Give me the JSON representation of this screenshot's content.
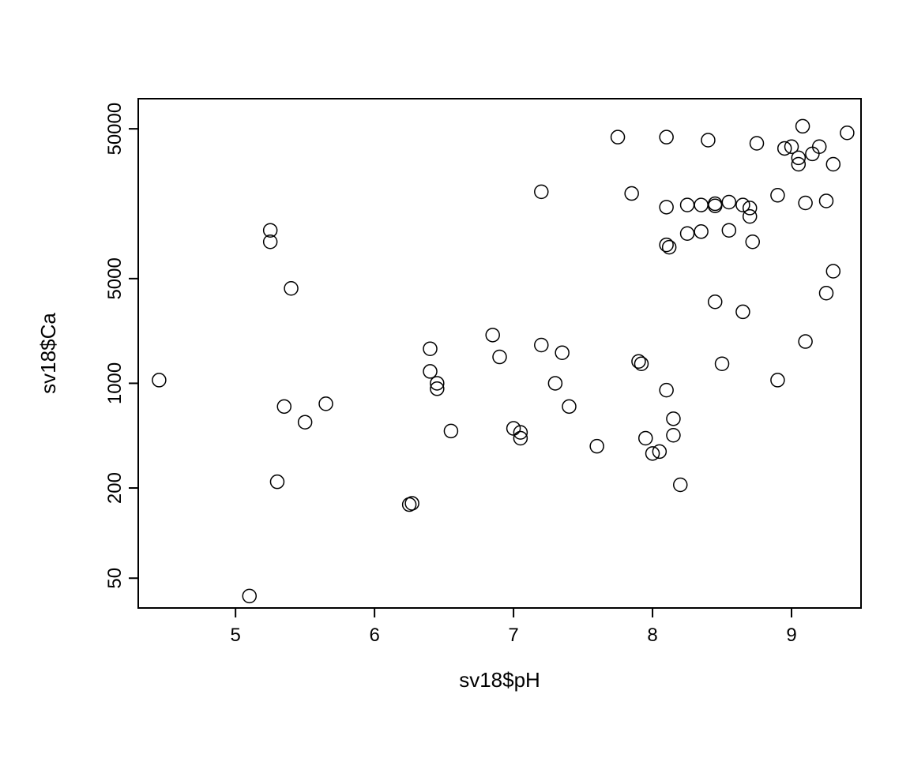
{
  "chart_data": {
    "type": "scatter",
    "xlabel": "sv18$pH",
    "ylabel": "sv18$Ca",
    "xlim": [
      4.3,
      9.5
    ],
    "ylim_log10": [
      1.5,
      4.9
    ],
    "x_ticks": [
      5,
      6,
      7,
      8,
      9
    ],
    "y_ticks": [
      50,
      200,
      1000,
      5000,
      50000
    ],
    "y_scale": "log",
    "points": [
      {
        "x": 4.45,
        "y": 1050
      },
      {
        "x": 5.1,
        "y": 38
      },
      {
        "x": 5.25,
        "y": 10500
      },
      {
        "x": 5.25,
        "y": 8800
      },
      {
        "x": 5.3,
        "y": 220
      },
      {
        "x": 5.35,
        "y": 700
      },
      {
        "x": 5.4,
        "y": 4300
      },
      {
        "x": 5.5,
        "y": 550
      },
      {
        "x": 5.65,
        "y": 730
      },
      {
        "x": 6.25,
        "y": 155
      },
      {
        "x": 6.27,
        "y": 158
      },
      {
        "x": 6.4,
        "y": 1700
      },
      {
        "x": 6.4,
        "y": 1200
      },
      {
        "x": 6.45,
        "y": 1000
      },
      {
        "x": 6.45,
        "y": 920
      },
      {
        "x": 6.55,
        "y": 480
      },
      {
        "x": 6.85,
        "y": 2100
      },
      {
        "x": 6.9,
        "y": 1500
      },
      {
        "x": 7.0,
        "y": 500
      },
      {
        "x": 7.05,
        "y": 470
      },
      {
        "x": 7.05,
        "y": 430
      },
      {
        "x": 7.2,
        "y": 1800
      },
      {
        "x": 7.2,
        "y": 19000
      },
      {
        "x": 7.3,
        "y": 1000
      },
      {
        "x": 7.35,
        "y": 1600
      },
      {
        "x": 7.4,
        "y": 700
      },
      {
        "x": 7.6,
        "y": 380
      },
      {
        "x": 7.75,
        "y": 44000
      },
      {
        "x": 7.85,
        "y": 18500
      },
      {
        "x": 7.9,
        "y": 1400
      },
      {
        "x": 7.92,
        "y": 1350
      },
      {
        "x": 7.95,
        "y": 430
      },
      {
        "x": 8.0,
        "y": 340
      },
      {
        "x": 8.05,
        "y": 350
      },
      {
        "x": 8.1,
        "y": 900
      },
      {
        "x": 8.1,
        "y": 44000
      },
      {
        "x": 8.1,
        "y": 8400
      },
      {
        "x": 8.12,
        "y": 8100
      },
      {
        "x": 8.1,
        "y": 15000
      },
      {
        "x": 8.15,
        "y": 580
      },
      {
        "x": 8.15,
        "y": 450
      },
      {
        "x": 8.2,
        "y": 210
      },
      {
        "x": 8.25,
        "y": 15500
      },
      {
        "x": 8.25,
        "y": 10000
      },
      {
        "x": 8.35,
        "y": 15500
      },
      {
        "x": 8.35,
        "y": 10300
      },
      {
        "x": 8.4,
        "y": 42000
      },
      {
        "x": 8.45,
        "y": 15800
      },
      {
        "x": 8.45,
        "y": 15300
      },
      {
        "x": 8.45,
        "y": 3500
      },
      {
        "x": 8.5,
        "y": 1350
      },
      {
        "x": 8.55,
        "y": 16200
      },
      {
        "x": 8.55,
        "y": 10500
      },
      {
        "x": 8.65,
        "y": 15500
      },
      {
        "x": 8.65,
        "y": 3000
      },
      {
        "x": 8.7,
        "y": 14800
      },
      {
        "x": 8.7,
        "y": 13000
      },
      {
        "x": 8.72,
        "y": 8800
      },
      {
        "x": 8.75,
        "y": 40000
      },
      {
        "x": 8.9,
        "y": 18000
      },
      {
        "x": 8.9,
        "y": 1050
      },
      {
        "x": 8.95,
        "y": 37000
      },
      {
        "x": 9.0,
        "y": 38000
      },
      {
        "x": 9.05,
        "y": 32000
      },
      {
        "x": 9.05,
        "y": 29000
      },
      {
        "x": 9.08,
        "y": 52000
      },
      {
        "x": 9.1,
        "y": 1900
      },
      {
        "x": 9.1,
        "y": 16000
      },
      {
        "x": 9.15,
        "y": 34000
      },
      {
        "x": 9.2,
        "y": 38000
      },
      {
        "x": 9.25,
        "y": 4000
      },
      {
        "x": 9.25,
        "y": 16500
      },
      {
        "x": 9.3,
        "y": 29000
      },
      {
        "x": 9.3,
        "y": 5600
      },
      {
        "x": 9.4,
        "y": 47000
      }
    ]
  }
}
